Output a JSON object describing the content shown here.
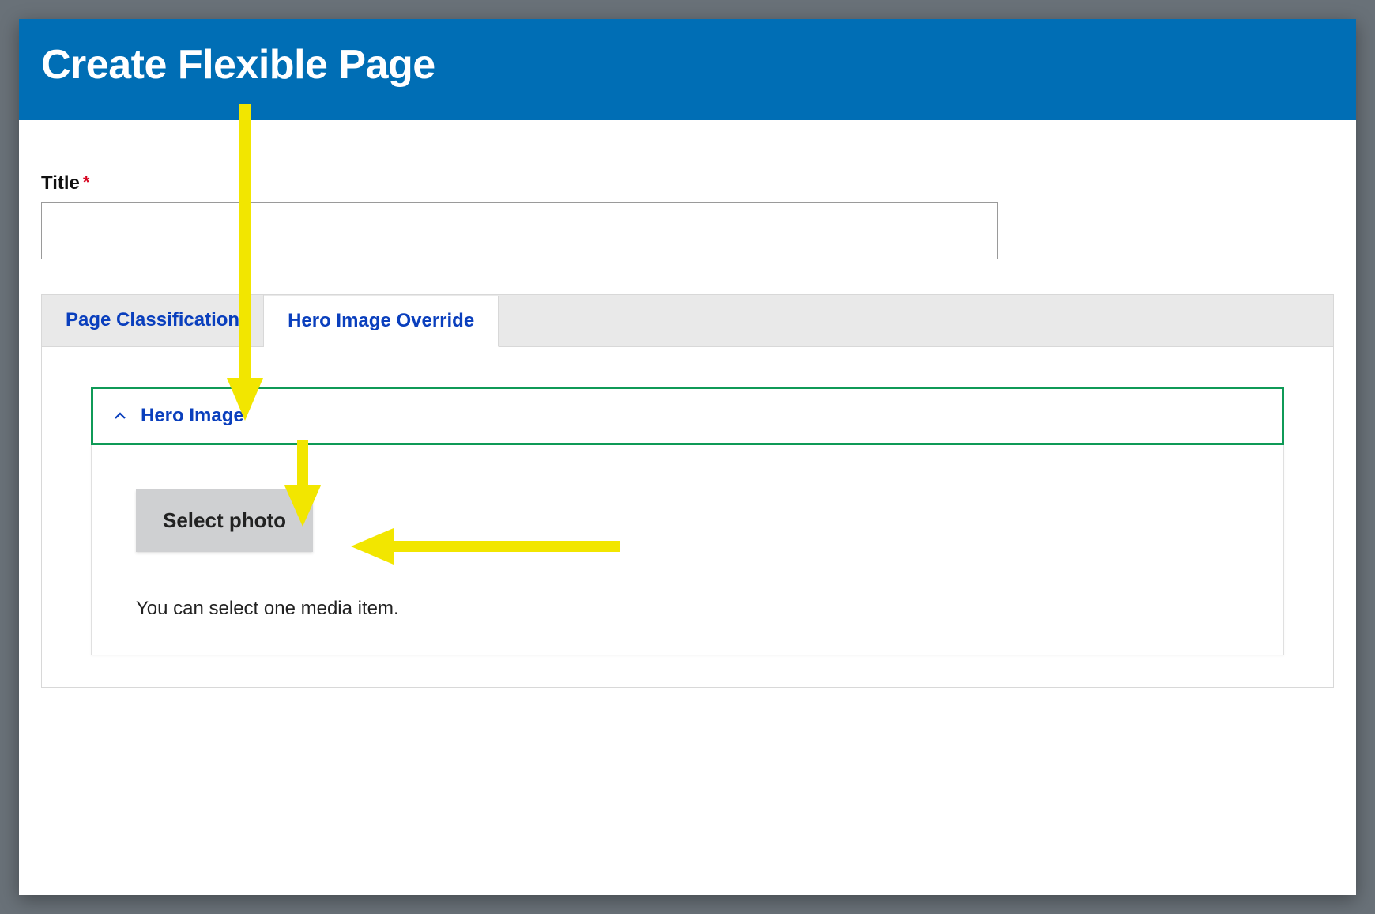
{
  "header": {
    "title": "Create Flexible Page"
  },
  "form": {
    "title_label": "Title",
    "required_mark": "*",
    "title_value": ""
  },
  "tabs": [
    {
      "label": "Page Classification",
      "active": false
    },
    {
      "label": "Hero Image Override",
      "active": true
    }
  ],
  "hero_panel": {
    "section_title": "Hero Image",
    "select_button_label": "Select photo",
    "help_text": "You can select one media item."
  },
  "colors": {
    "header_bg": "#006eb5",
    "accent_link": "#0a3fbd",
    "highlight_border": "#0f9a57",
    "annotation": "#f2e600",
    "required": "#d6001c"
  }
}
